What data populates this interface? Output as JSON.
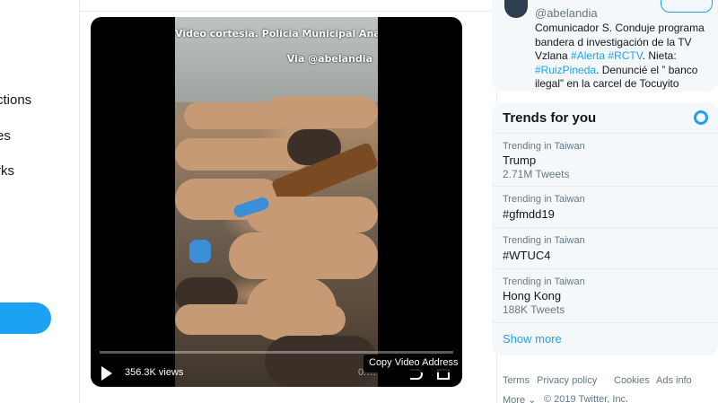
{
  "left_nav": {
    "items": [
      "ctions",
      "es",
      "rks"
    ]
  },
  "video": {
    "caption_top": "Video cortesia. Policia Municipal Anaco.",
    "caption_via": "Via @abelandia",
    "views": "356.3K views",
    "time_display": "0:…",
    "copy_tooltip": "Copy Video Address",
    "progress_fraction": 0.0
  },
  "profile": {
    "handle": "@abelandia",
    "bio_text_1": "Comunicador S. Conduje programa bandera d investigación de la TV Vzlana ",
    "bio_tag_1": "#Alerta",
    "bio_tag_2": "#RCTV",
    "bio_text_2": ". Nieta: ",
    "bio_tag_3": "#RuizPineda",
    "bio_text_3": ". Denuncié el ” banco ilegal” en la carcel de Tocuyito"
  },
  "trends": {
    "title": "Trends for you",
    "items": [
      {
        "context": "Trending in Taiwan",
        "name": "Trump",
        "count": "2.71M Tweets"
      },
      {
        "context": "Trending in Taiwan",
        "name": "#gfmdd19",
        "count": ""
      },
      {
        "context": "Trending in Taiwan",
        "name": "#WTUC4",
        "count": ""
      },
      {
        "context": "Trending in Taiwan",
        "name": "Hong Kong",
        "count": "188K Tweets"
      }
    ],
    "show_more": "Show more"
  },
  "footer": {
    "terms": "Terms",
    "privacy": "Privacy policy",
    "cookies": "Cookies",
    "ads": "Ads info",
    "more": "More ⌄",
    "copyright": "© 2019 Twitter, Inc."
  },
  "colors": {
    "accent": "#1da1f2",
    "text": "#14171a",
    "muted": "#657786",
    "panel": "#f5f8fa"
  }
}
